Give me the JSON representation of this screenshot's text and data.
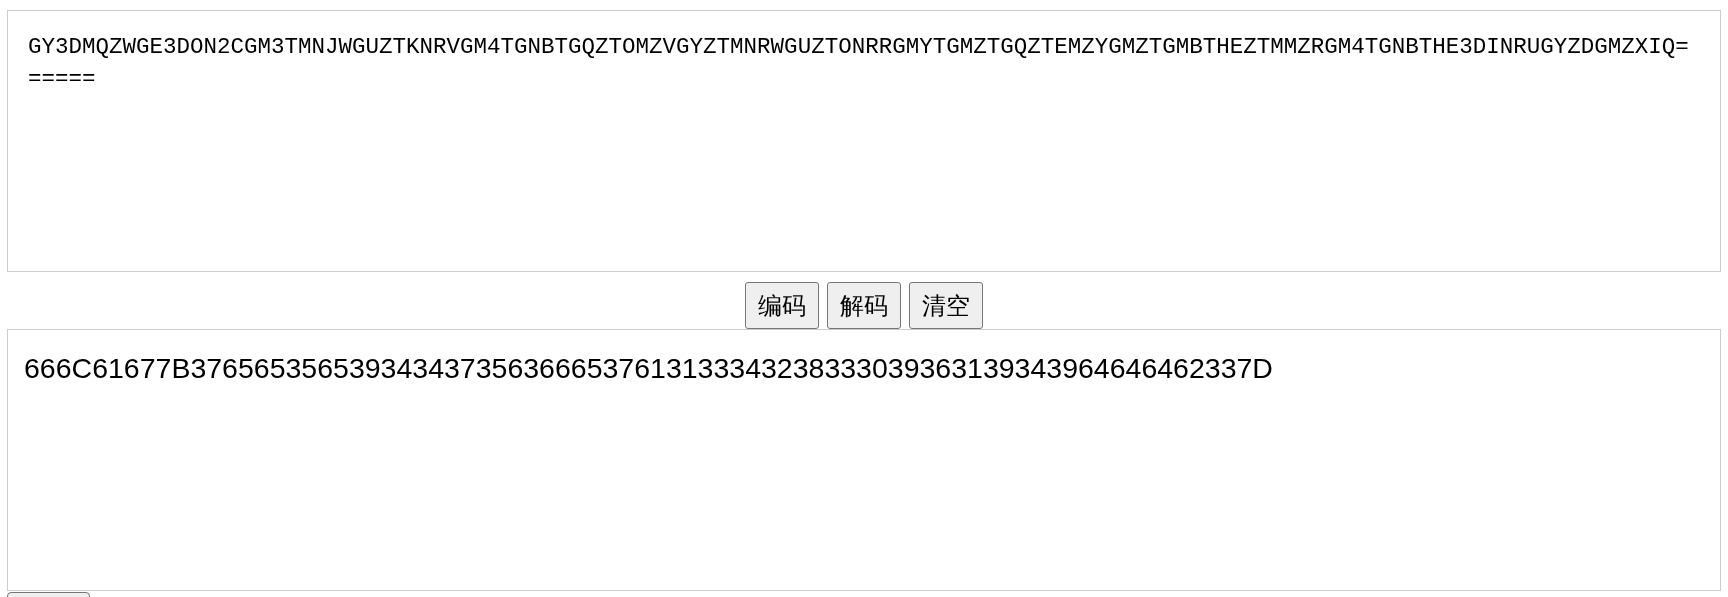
{
  "input": {
    "value": "GY3DMQZWGE3DON2CGM3TMNJWGUZTKNRVGM4TGNBTGQZTOMZVGYZTMNRWGUZTONRRGMYTGMZTGQZTEMZYGMZTGMBTHEZTMMZRGM4TGNBTHE3DINRUGYZDGMZXIQ======"
  },
  "buttons": [
    {
      "label": "编码"
    },
    {
      "label": "解码"
    },
    {
      "label": "清空"
    }
  ],
  "output": {
    "value": "666C61677B3765653565393434373563666537613133343238333039363139343964646462337D"
  }
}
